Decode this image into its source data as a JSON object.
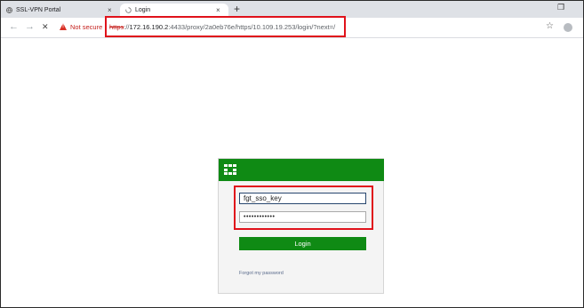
{
  "browser": {
    "tabs": [
      {
        "label": "SSL-VPN Portal",
        "close": "×"
      },
      {
        "label": "Login",
        "close": "×"
      }
    ],
    "new_tab": "+",
    "window_controls": {
      "restore": "❐"
    },
    "nav": {
      "back": "←",
      "forward": "→",
      "stop": "✕"
    },
    "security_label": "Not secure",
    "url": {
      "scheme": "https",
      "sep": "://",
      "host": "172.16.190.2",
      "rest": ":4433/proxy/2a0eb76e/https/10.109.19.253/login/?next=/"
    },
    "bookmark_icon": "☆"
  },
  "login": {
    "username_value": "fgt_sso_key",
    "password_value": "••••••••••••",
    "login_label": "Login",
    "forgot_label": "Forgot my password"
  },
  "colors": {
    "brand_green": "#0f8a14",
    "highlight_red": "#e0121b",
    "warning_red": "#c5221f"
  },
  "icons": [
    "globe-icon",
    "loading-spinner-icon",
    "close-icon",
    "plus-icon",
    "back-arrow-icon",
    "forward-arrow-icon",
    "stop-icon",
    "warning-icon",
    "star-icon",
    "profile-icon",
    "fortinet-logo-icon"
  ]
}
